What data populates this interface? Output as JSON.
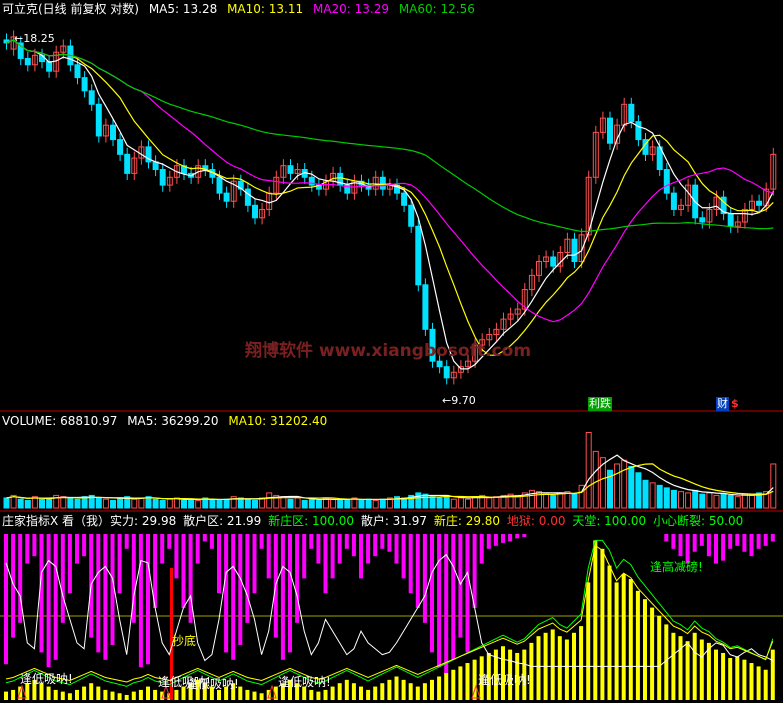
{
  "colors": {
    "bg": "#000000",
    "up": "#ff5050",
    "down": "#00e0ff",
    "ma5": "#ffffff",
    "ma10": "#ffff00",
    "ma20": "#ff00ff",
    "ma60": "#00cc00",
    "divider": "#c00000",
    "magenta_bar": "#ff00ff",
    "yellow_bar": "#ffff00",
    "watermark": "#7a2020"
  },
  "price_panel": {
    "title": "可立克(日线 前复权 对数)",
    "ma5": "MA5: 13.28",
    "ma10": "MA10: 13.11",
    "ma20": "MA20: 13.29",
    "ma60": "MA60: 12.56",
    "high_label": "18.25",
    "low_label": "9.70",
    "watermark": "翔博软件 www.xiangbosoft.com",
    "markers": [
      "利跌",
      "财",
      "$"
    ]
  },
  "volume_panel": {
    "title": "VOLUME: 68810.97",
    "ma5": "MA5: 36299.20",
    "ma10": "MA10: 31202.40"
  },
  "indicator_panel": {
    "title": "庄家指标X 看（我）实力: 29.98",
    "sanhu_qu": "散户区: 21.99",
    "xinzhuang_qu": "新庄区: 100.00",
    "sanhu": "散户: 31.97",
    "xinzhuang": "新庄: 29.80",
    "diyu": "地狱: 0.00",
    "tiantang": "天堂: 100.00",
    "xiaoxin": "小心断裂: 50.00",
    "labels": {
      "feng_gao": "逢高减磅!",
      "chao_di": "抄底",
      "feng_di_1": "逢低吸呐!",
      "feng_di_2": "逢低吸呐!",
      "feng_di_3": "逢低吸呐!",
      "feng_di_4": "逢低吸呐!",
      "feng_di_5": "逢低吸呐!"
    }
  },
  "chart_data": [
    {
      "type": "candlestick",
      "title": "可立克(日线 前复权 对数)",
      "series": [
        {
          "name": "MA5",
          "last": 13.28
        },
        {
          "name": "MA10",
          "last": 13.11
        },
        {
          "name": "MA20",
          "last": 13.29
        },
        {
          "name": "MA60",
          "last": 12.56
        }
      ],
      "annotations": {
        "high": 18.25,
        "low": 9.7
      },
      "closes": [
        17.9,
        18.1,
        17.4,
        17.2,
        17.5,
        17.3,
        17.0,
        17.6,
        17.8,
        17.2,
        16.8,
        16.4,
        16.0,
        15.1,
        15.4,
        15.0,
        14.6,
        14.1,
        14.5,
        14.8,
        14.4,
        14.2,
        13.8,
        14.0,
        14.3,
        14.1,
        14.0,
        14.3,
        14.2,
        14.0,
        13.6,
        13.4,
        13.9,
        13.7,
        13.3,
        13.0,
        13.2,
        13.6,
        14.0,
        14.3,
        14.1,
        14.2,
        14.0,
        13.8,
        13.7,
        13.9,
        14.1,
        13.8,
        13.6,
        13.9,
        13.8,
        13.7,
        14.0,
        13.7,
        13.8,
        13.6,
        13.3,
        12.8,
        11.5,
        10.6,
        10.0,
        9.9,
        9.7,
        9.8,
        9.9,
        10.0,
        10.3,
        10.4,
        10.5,
        10.6,
        10.8,
        10.9,
        11.0,
        11.4,
        11.7,
        12.0,
        12.1,
        11.9,
        12.2,
        12.5,
        12.0,
        12.6,
        14.0,
        15.2,
        15.6,
        14.9,
        15.4,
        16.0,
        15.5,
        15.0,
        14.6,
        14.8,
        14.2,
        13.6,
        13.2,
        13.3,
        13.8,
        13.0,
        12.9,
        13.2,
        13.5,
        13.1,
        12.8,
        12.9,
        13.2,
        13.4,
        13.3,
        13.7,
        14.6
      ],
      "opens": [
        18.0,
        17.7,
        17.9,
        17.4,
        17.2,
        17.5,
        17.3,
        17.0,
        17.6,
        17.8,
        17.2,
        16.8,
        16.4,
        16.0,
        15.1,
        15.4,
        15.0,
        14.6,
        14.1,
        14.5,
        14.8,
        14.4,
        14.2,
        13.8,
        14.0,
        14.3,
        14.1,
        14.0,
        14.3,
        14.2,
        14.0,
        13.6,
        13.4,
        13.9,
        13.7,
        13.3,
        13.0,
        13.2,
        13.6,
        14.0,
        14.3,
        14.1,
        14.2,
        14.0,
        13.8,
        13.7,
        13.9,
        14.1,
        13.8,
        13.6,
        13.9,
        13.8,
        13.7,
        14.0,
        13.7,
        13.8,
        13.6,
        13.3,
        12.8,
        11.5,
        10.6,
        10.0,
        9.9,
        9.7,
        9.8,
        9.9,
        10.0,
        10.3,
        10.4,
        10.5,
        10.6,
        10.8,
        10.9,
        11.0,
        11.4,
        11.7,
        12.0,
        12.1,
        11.9,
        12.2,
        12.5,
        12.0,
        12.6,
        14.0,
        15.2,
        15.6,
        14.9,
        15.4,
        16.0,
        15.5,
        15.0,
        14.6,
        14.8,
        14.2,
        13.6,
        13.2,
        13.3,
        13.8,
        13.0,
        12.9,
        13.2,
        13.5,
        13.1,
        12.8,
        12.9,
        13.2,
        13.4,
        13.3,
        13.7
      ],
      "volumes": [
        8,
        10,
        7,
        6,
        9,
        7,
        8,
        10,
        9,
        8,
        7,
        9,
        10,
        8,
        7,
        6,
        8,
        9,
        7,
        8,
        9,
        7,
        6,
        7,
        8,
        6,
        7,
        6,
        8,
        7,
        6,
        7,
        9,
        8,
        7,
        6,
        8,
        12,
        10,
        9,
        7,
        8,
        6,
        7,
        6,
        8,
        7,
        6,
        7,
        8,
        6,
        7,
        6,
        7,
        8,
        9,
        8,
        10,
        12,
        11,
        9,
        8,
        10,
        7,
        8,
        7,
        9,
        10,
        8,
        9,
        10,
        11,
        10,
        12,
        14,
        13,
        11,
        10,
        12,
        13,
        11,
        18,
        60,
        45,
        40,
        30,
        35,
        38,
        33,
        28,
        22,
        20,
        18,
        16,
        14,
        13,
        12,
        14,
        11,
        12,
        10,
        11,
        10,
        9,
        11,
        10,
        12,
        13,
        35
      ]
    },
    {
      "type": "line",
      "title": "VOLUME: 68810.97",
      "series": [
        {
          "name": "MA5",
          "last": 36299.2
        },
        {
          "name": "MA10",
          "last": 31202.4
        }
      ]
    },
    {
      "type": "bar",
      "title": "庄家指标X",
      "series": [
        {
          "name": "看（我）实力",
          "last": 29.98
        },
        {
          "name": "散户区",
          "last": 21.99
        },
        {
          "name": "新庄区",
          "last": 100.0
        },
        {
          "name": "散户",
          "last": 31.97
        },
        {
          "name": "新庄",
          "last": 29.8
        },
        {
          "name": "地狱",
          "last": 0.0
        },
        {
          "name": "天堂",
          "last": 100.0
        },
        {
          "name": "小心断裂",
          "last": 50.0
        }
      ],
      "sanhu_bars": [
        88,
        70,
        60,
        20,
        15,
        80,
        90,
        85,
        60,
        40,
        20,
        15,
        70,
        80,
        85,
        75,
        40,
        10,
        60,
        90,
        88,
        50,
        20,
        10,
        30,
        50,
        60,
        20,
        5,
        10,
        40,
        80,
        85,
        75,
        60,
        40,
        10,
        30,
        70,
        85,
        80,
        60,
        30,
        10,
        20,
        40,
        30,
        20,
        10,
        15,
        30,
        20,
        15,
        10,
        12,
        20,
        30,
        40,
        50,
        60,
        80,
        90,
        95,
        85,
        70,
        80,
        50,
        20,
        10,
        8,
        6,
        5,
        3,
        2,
        0,
        0,
        0,
        0,
        0,
        0,
        0,
        0,
        0,
        0,
        0,
        0,
        0,
        0,
        0,
        0,
        0,
        0,
        0,
        5,
        10,
        15,
        20,
        12,
        8,
        15,
        20,
        18,
        10,
        8,
        12,
        15,
        10,
        8,
        5
      ],
      "zhuang_bars": [
        5,
        6,
        8,
        10,
        12,
        10,
        8,
        6,
        5,
        4,
        6,
        8,
        10,
        8,
        6,
        5,
        4,
        3,
        5,
        6,
        8,
        6,
        5,
        4,
        6,
        8,
        10,
        12,
        10,
        8,
        6,
        8,
        10,
        8,
        6,
        5,
        4,
        6,
        8,
        10,
        12,
        10,
        8,
        6,
        5,
        6,
        8,
        10,
        12,
        10,
        8,
        6,
        8,
        10,
        12,
        14,
        12,
        10,
        8,
        10,
        12,
        14,
        16,
        18,
        20,
        22,
        24,
        26,
        28,
        30,
        32,
        30,
        28,
        30,
        34,
        38,
        40,
        42,
        38,
        36,
        40,
        44,
        70,
        95,
        90,
        80,
        70,
        75,
        72,
        65,
        60,
        55,
        50,
        45,
        40,
        38,
        35,
        40,
        36,
        34,
        30,
        28,
        25,
        26,
        24,
        22,
        20,
        18,
        30
      ]
    }
  ]
}
